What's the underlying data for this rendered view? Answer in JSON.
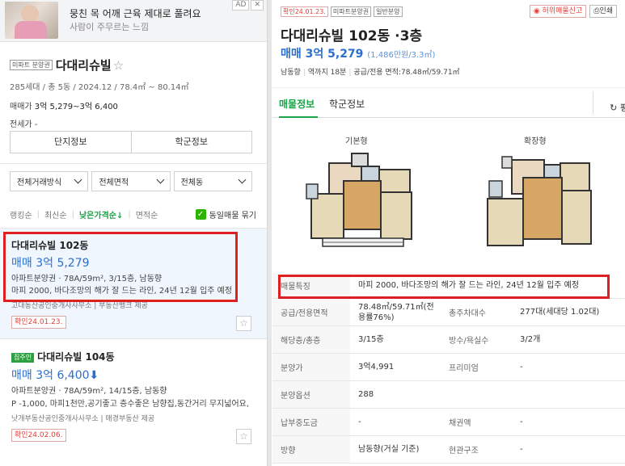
{
  "ad": {
    "title": "뭉친 목 어깨 근육 제대로 풀려요",
    "subtitle": "사람이 주무르는 느낌",
    "badges": [
      "AD",
      "✕"
    ]
  },
  "complex": {
    "tag": "미파트 분양권",
    "name": "다대리슈빌",
    "info": "285세대 / 총 5동 / 2024.12 / 78.4㎡ ~ 80.14㎡",
    "price_label": "매매가",
    "price_value": "3억 5,279~3억 6,400",
    "jeonse": "전세가 -"
  },
  "buttons": {
    "complex_info": "단지정보",
    "school_info": "학군정보"
  },
  "filters": [
    "전체거래방식",
    "전체면적",
    "전체동"
  ],
  "sort": {
    "options": [
      "랭킹순",
      "최신순",
      "낮은가격순↓",
      "면적순"
    ],
    "active_index": 2,
    "same_listing_label": "동일매물 묶기",
    "same_listing_checked": true
  },
  "listings": [
    {
      "title": "다대리슈빌 102동",
      "price": "매매 3억 5,279",
      "detail": "아파트분양권 · 78A/59m², 3/15층, 남동향",
      "desc": "마피 2000, 바다조망의 해가 잘 드는 라인, 24년 12월 입주 예정",
      "agent": "고대동산공인중개사사무소 | 부동산뱅크 제공",
      "confirmed": "확인24.01.23."
    },
    {
      "tag": "집주인",
      "title": "다대리슈빌 104동",
      "price": "매매 3억 6,400",
      "price_arrow": "⬇",
      "detail": "아파트분양권 · 78A/59m², 14/15층, 남동향",
      "desc": "P -1,000, 마피1천만,공기좋고 층수좋은 남향집,동간거리 무지넓어요,",
      "agent": "낫개부동산공인중개사사무소 | 매경부동산 제공",
      "confirmed": "확인24.02.06."
    }
  ],
  "detail": {
    "tags": [
      "확인24.01.23.",
      "미파트분양권",
      "일반분양"
    ],
    "actions": {
      "report": "허위매물신고",
      "print": "인쇄"
    },
    "title": "다대리슈빌 102동 ·3층",
    "price": "매매 3억 5,279",
    "price_per": "(1,486만원/3.3㎡)",
    "meta": [
      "남동향",
      "역까지 18분",
      "공급/전용 면적:78.48㎡/59.71㎡"
    ],
    "tabs": [
      "매물정보",
      "학군정보"
    ],
    "refresh": "평",
    "plans": [
      "기본형",
      "확장형"
    ],
    "rows": [
      {
        "label": "매물특징",
        "value": "마피 2000, 바다조망의 해가 잘 드는 라인, 24년 12월 입주 예정"
      },
      {
        "label": "공급/전용면적",
        "value": "78.48㎡/59.71㎡(전용률76%)",
        "label2": "총주차대수",
        "value2": "277대(세대당 1.02대)"
      },
      {
        "label": "해당층/총층",
        "value": "3/15층",
        "label2": "방수/욕실수",
        "value2": "3/2개"
      },
      {
        "label": "분양가",
        "value": "3억4,991",
        "label2": "프리미엄",
        "value2": "-"
      },
      {
        "label": "분양옵션",
        "value": "288"
      },
      {
        "label": "납부중도금",
        "value": "-",
        "label2": "채권액",
        "value2": "-"
      },
      {
        "label": "방향",
        "value": "남동향(거실 기준)",
        "label2": "현관구조",
        "value2": "-"
      }
    ]
  }
}
